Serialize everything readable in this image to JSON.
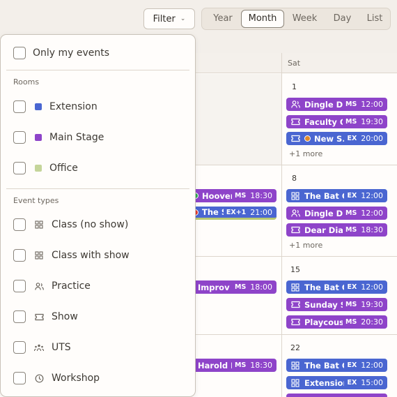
{
  "toolbar": {
    "filter_label": "Filter",
    "views": [
      "Year",
      "Month",
      "Week",
      "Day",
      "List"
    ],
    "active_view": "Month"
  },
  "colors": {
    "main_stage": "#8e44c9",
    "extension": "#4a66d1",
    "office": "#c5d59a",
    "accent_border": "#8a8378"
  },
  "calendar": {
    "day_header": "Sat",
    "sat_days": [
      "1",
      "8",
      "15",
      "22"
    ],
    "friday_events": [
      {
        "title": "Hoover",
        "room": "MS",
        "time": "18:30",
        "dot": "green"
      },
      {
        "title": "The S...",
        "room": "EX+1",
        "time": "21:00",
        "dot": "red"
      },
      {
        "title": "Improv G...",
        "room": "MS",
        "time": "18:00"
      },
      {
        "title": "Harold Ni...",
        "room": "MS",
        "time": "18:30"
      }
    ],
    "saturday_week1": [
      {
        "title": "Dingle Dr...",
        "room": "MS",
        "time": "12:00",
        "icon": "practice"
      },
      {
        "title": "Faculty O...",
        "room": "MS",
        "time": "19:30",
        "icon": "show"
      },
      {
        "title": "New S...",
        "room": "EX",
        "time": "20:00",
        "icon": "show"
      }
    ],
    "saturday_week1_more": "+1 more",
    "saturday_week2": [
      {
        "title": "The Bat C...",
        "room": "EX",
        "time": "12:00",
        "icon": "class"
      },
      {
        "title": "Dingle Dr...",
        "room": "MS",
        "time": "12:00",
        "icon": "practice"
      },
      {
        "title": "Dear Dia...",
        "room": "MS",
        "time": "18:30",
        "icon": "show"
      }
    ],
    "saturday_week2_more": "+1 more",
    "saturday_week3": [
      {
        "title": "The Bat C...",
        "room": "EX",
        "time": "12:00",
        "icon": "class"
      },
      {
        "title": "Sunday S...",
        "room": "MS",
        "time": "19:30",
        "icon": "show"
      },
      {
        "title": "Playcous...",
        "room": "MS",
        "time": "20:30",
        "icon": "show"
      }
    ],
    "saturday_week4": [
      {
        "title": "The Bat C...",
        "room": "EX",
        "time": "12:00",
        "icon": "class"
      },
      {
        "title": "Extension...",
        "room": "EX",
        "time": "15:00",
        "icon": "class"
      }
    ]
  },
  "filter_panel": {
    "only_mine": "Only my events",
    "rooms_heading": "Rooms",
    "rooms": [
      "Extension",
      "Main Stage",
      "Office"
    ],
    "types_heading": "Event types",
    "types": [
      "Class (no show)",
      "Class with show",
      "Practice",
      "Show",
      "UTS",
      "Workshop"
    ]
  }
}
